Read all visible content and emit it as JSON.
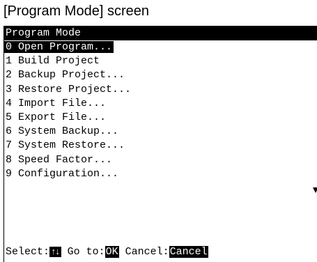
{
  "caption": "[Program Mode] screen",
  "screen": {
    "title": "Program Mode",
    "menu_items": [
      {
        "label": "0 Open Program..."
      },
      {
        "label": "1 Build Project"
      },
      {
        "label": "2 Backup Project..."
      },
      {
        "label": "3 Restore Project..."
      },
      {
        "label": "4 Import File..."
      },
      {
        "label": "5 Export File..."
      },
      {
        "label": "6 System Backup..."
      },
      {
        "label": "7 System Restore..."
      },
      {
        "label": "8 Speed Factor..."
      },
      {
        "label": "9 Configuration..."
      }
    ],
    "selected_index": 0,
    "scroll_indicator": "scroll-down-arrow-icon"
  },
  "status": {
    "select_label": "Select:",
    "select_key": "↑↓",
    "goto_label": " Go to:",
    "goto_key": "OK",
    "cancel_label": " Cancel:",
    "cancel_key": "Cancel"
  }
}
